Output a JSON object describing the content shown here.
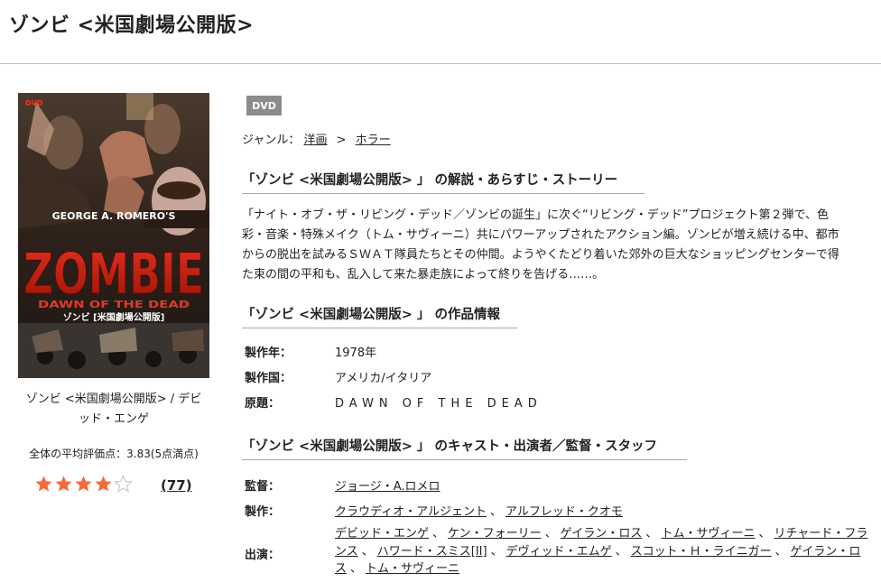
{
  "page_title": "ゾンビ <米国劇場公開版>",
  "poster": {
    "top_text": "GEORGE A. ROMERO'S",
    "main_title": "ZOMBIE",
    "sub_title": "DAWN OF THE DEAD",
    "jp_title": "ゾンビ [米国劇場公開版]",
    "corner_mark": "DVD"
  },
  "caption": {
    "line1": "ゾンビ <米国劇場公開版> / デビ",
    "line2": "ッド・エンゲ"
  },
  "rating": {
    "avg_text": "全体の平均評価点：3.83(5点満点)",
    "value": 3.83,
    "max": 5,
    "count_text": "(77)",
    "star_color": "#f26b3a",
    "star_empty_color": "#cccccc"
  },
  "badge": "DVD",
  "genre": {
    "label": "ジャンル：",
    "items": [
      "洋画",
      "ホラー"
    ],
    "separator": ">"
  },
  "section_synopsis": {
    "heading": "「ゾンビ <米国劇場公開版> 」 の解説・あらすじ・ストーリー",
    "lines": [
      "「ナイト・オブ・ザ・リビング・デッド／ゾンビの誕生」に次ぐ“リビング・デッド”プロジェクト第２弾で、色",
      "彩・音楽・特殊メイク（トム・サヴィーニ）共にパワーアップされたアクション編。ゾンビが増え続ける中、都市",
      "からの脱出を試みるＳＷＡＴ隊員たちとその仲間。ようやくたどり着いた郊外の巨大なショッピングセンターで得",
      "た束の間の平和も、乱入して来た暴走族によって終りを告げる……。"
    ]
  },
  "section_info": {
    "heading": "「ゾンビ <米国劇場公開版> 」 の作品情報",
    "rows": [
      {
        "label": "製作年：",
        "value": "1978年"
      },
      {
        "label": "製作国：",
        "value": "アメリカ/イタリア"
      },
      {
        "label": "原題：",
        "value": "DAWN OF THE DEAD"
      }
    ]
  },
  "section_cast": {
    "heading": "「ゾンビ <米国劇場公開版> 」 のキャスト・出演者／監督・スタッフ",
    "director_label": "監督：",
    "directors": [
      "ジョージ・A.ロメロ"
    ],
    "producer_label": "製作：",
    "producers": [
      "クラウディオ・アルジェント",
      "アルフレッド・クオモ"
    ],
    "cast_label": "出演：",
    "cast": [
      "デビッド・エンゲ",
      "ケン・フォーリー",
      "ゲイラン・ロス",
      "トム・サヴィーニ",
      "リチャード・フランス",
      "ハワード・スミス[II]",
      "デヴィッド・エムゲ",
      "スコット・Ｈ・ライニガー",
      "ゲイラン・ロス",
      "トム・サヴィーニ"
    ],
    "separator": "、"
  }
}
